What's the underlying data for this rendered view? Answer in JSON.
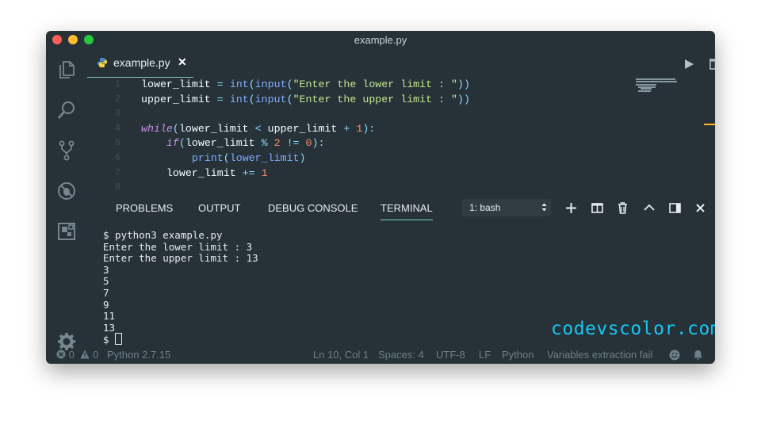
{
  "window": {
    "title": "example.py"
  },
  "tab": {
    "label": "example.py",
    "close": "✕"
  },
  "code_lines": [
    {
      "n": "1",
      "segs": [
        {
          "t": "lower_limit ",
          "c": "p"
        },
        {
          "t": "=",
          "c": "op"
        },
        {
          "t": " ",
          "c": "p"
        },
        {
          "t": "int",
          "c": "fn"
        },
        {
          "t": "(",
          "c": "op"
        },
        {
          "t": "input",
          "c": "fn"
        },
        {
          "t": "(",
          "c": "op"
        },
        {
          "t": "\"Enter the lower limit : \"",
          "c": "str"
        },
        {
          "t": "))",
          "c": "op"
        }
      ]
    },
    {
      "n": "2",
      "segs": [
        {
          "t": "upper_limit ",
          "c": "p"
        },
        {
          "t": "=",
          "c": "op"
        },
        {
          "t": " ",
          "c": "p"
        },
        {
          "t": "int",
          "c": "fn"
        },
        {
          "t": "(",
          "c": "op"
        },
        {
          "t": "input",
          "c": "fn"
        },
        {
          "t": "(",
          "c": "op"
        },
        {
          "t": "\"Enter the upper limit : \"",
          "c": "str"
        },
        {
          "t": "))",
          "c": "op"
        }
      ]
    },
    {
      "n": "3",
      "segs": []
    },
    {
      "n": "4",
      "segs": [
        {
          "t": "while",
          "c": "kw"
        },
        {
          "t": "(",
          "c": "op"
        },
        {
          "t": "lower_limit ",
          "c": "p"
        },
        {
          "t": "<",
          "c": "op"
        },
        {
          "t": " upper_limit ",
          "c": "p"
        },
        {
          "t": "+",
          "c": "op"
        },
        {
          "t": " ",
          "c": "p"
        },
        {
          "t": "1",
          "c": "num"
        },
        {
          "t": "):",
          "c": "op"
        }
      ]
    },
    {
      "n": "5",
      "segs": [
        {
          "t": "    ",
          "c": "p"
        },
        {
          "t": "if",
          "c": "kw"
        },
        {
          "t": "(",
          "c": "op"
        },
        {
          "t": "lower_limit ",
          "c": "p"
        },
        {
          "t": "%",
          "c": "op"
        },
        {
          "t": " ",
          "c": "p"
        },
        {
          "t": "2",
          "c": "num"
        },
        {
          "t": " ",
          "c": "p"
        },
        {
          "t": "!=",
          "c": "op"
        },
        {
          "t": " ",
          "c": "p"
        },
        {
          "t": "0",
          "c": "num"
        },
        {
          "t": "):",
          "c": "op"
        }
      ]
    },
    {
      "n": "6",
      "segs": [
        {
          "t": "        ",
          "c": "p"
        },
        {
          "t": "print",
          "c": "fn"
        },
        {
          "t": "(",
          "c": "op"
        },
        {
          "t": "lower_limit",
          "c": "fn"
        },
        {
          "t": ")",
          "c": "op"
        }
      ]
    },
    {
      "n": "7",
      "segs": [
        {
          "t": "    lower_limit ",
          "c": "p"
        },
        {
          "t": "+=",
          "c": "op"
        },
        {
          "t": " ",
          "c": "p"
        },
        {
          "t": "1",
          "c": "num"
        }
      ]
    },
    {
      "n": "8",
      "segs": []
    }
  ],
  "panel": {
    "tabs": [
      "PROBLEMS",
      "OUTPUT",
      "DEBUG CONSOLE",
      "TERMINAL"
    ],
    "active_tab": "TERMINAL",
    "terminal_select": "1: bash"
  },
  "terminal_lines": [
    "$ python3 example.py",
    "Enter the lower limit : 3",
    "Enter the upper limit : 13",
    "3",
    "5",
    "7",
    "9",
    "11",
    "13",
    "$ "
  ],
  "status": {
    "errors": "0",
    "warnings": "0",
    "interpreter": "Python 2.7.15",
    "position": "Ln 10, Col 1",
    "spaces": "Spaces: 4",
    "encoding": "UTF-8",
    "eol": "LF",
    "language": "Python",
    "message": "Variables extraction fail"
  },
  "watermark": "codevscolor.com",
  "icons": {
    "explorer": "files-icon",
    "search": "search-icon",
    "scm": "source-control-icon",
    "debug": "debug-icon",
    "extensions": "extensions-icon",
    "settings": "gear-icon",
    "python": "python-icon",
    "run": "play-icon",
    "split": "split-editor-icon",
    "more": "ellipsis-icon",
    "add": "plus-icon",
    "split_terminal": "split-terminal-icon",
    "trash": "trash-icon",
    "maximize": "chevron-up-icon",
    "panel_toggle": "panel-toggle-icon",
    "close": "close-icon",
    "smiley": "smiley-icon",
    "bell": "bell-icon"
  },
  "colors": {
    "background": "#263238",
    "accent": "#80cbc4",
    "string": "#c3e88d",
    "keyword": "#c792ea",
    "function": "#82aaff",
    "number": "#f78c6c",
    "operator": "#89ddff",
    "watermark": "#17c6f3"
  }
}
